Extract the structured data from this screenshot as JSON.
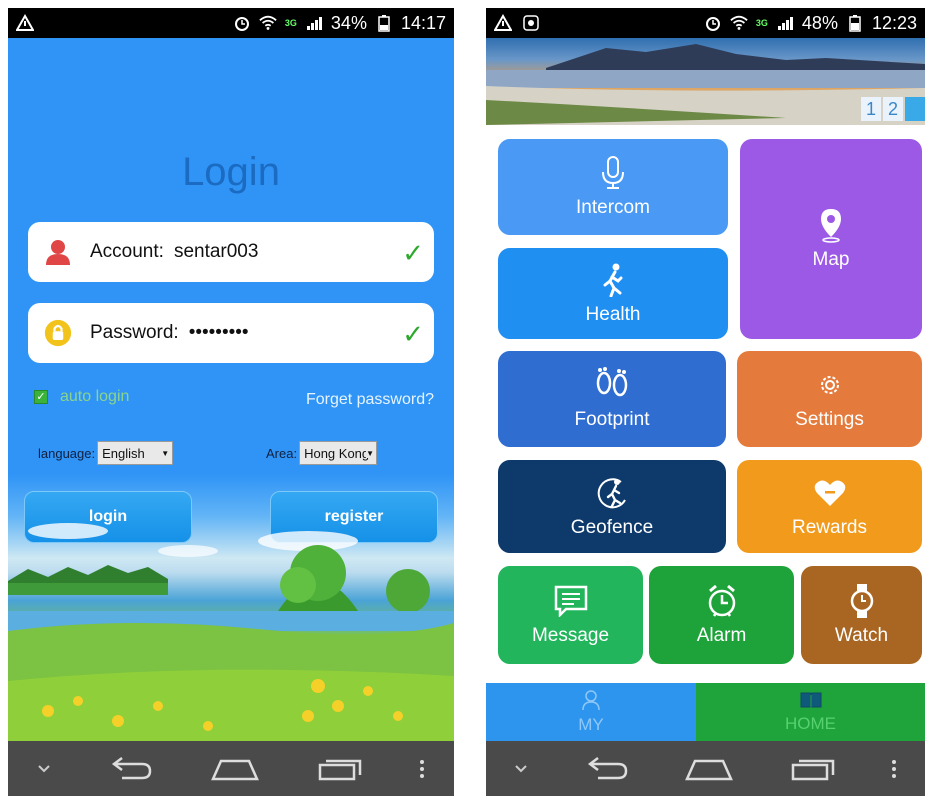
{
  "status_left": {
    "battery": "34%",
    "time": "14:17",
    "net": "3G"
  },
  "status_right": {
    "battery": "48%",
    "time": "12:23",
    "net": "3G"
  },
  "login": {
    "title": "Login",
    "account_label": "Account:",
    "account_value": "sentar003",
    "password_label": "Password:",
    "password_value": "•••••••••",
    "auto_login_label": "auto login",
    "forget_password": "Forget password?",
    "language_label": "language:",
    "language_value": "English",
    "area_label": "Area:",
    "area_value": "Hong Kong",
    "login_button": "login",
    "register_button": "register"
  },
  "home": {
    "pager": [
      "1",
      "2",
      "3"
    ],
    "tiles": {
      "intercom": "Intercom",
      "map": "Map",
      "health": "Health",
      "footprint": "Footprint",
      "settings": "Settings",
      "geofence": "Geofence",
      "rewards": "Rewards",
      "message": "Message",
      "alarm": "Alarm",
      "watch": "Watch"
    },
    "tabs": {
      "my": "MY",
      "home": "HOME"
    }
  },
  "colors": {
    "intercom": "#4a9af5",
    "map": "#9b59e6",
    "health": "#1f8ff2",
    "footprint": "#2f6dd0",
    "settings": "#e47b3c",
    "geofence": "#0e3a6b",
    "rewards": "#f29a1c",
    "message": "#22b55c",
    "alarm": "#1ea33a",
    "watch": "#a86622"
  }
}
